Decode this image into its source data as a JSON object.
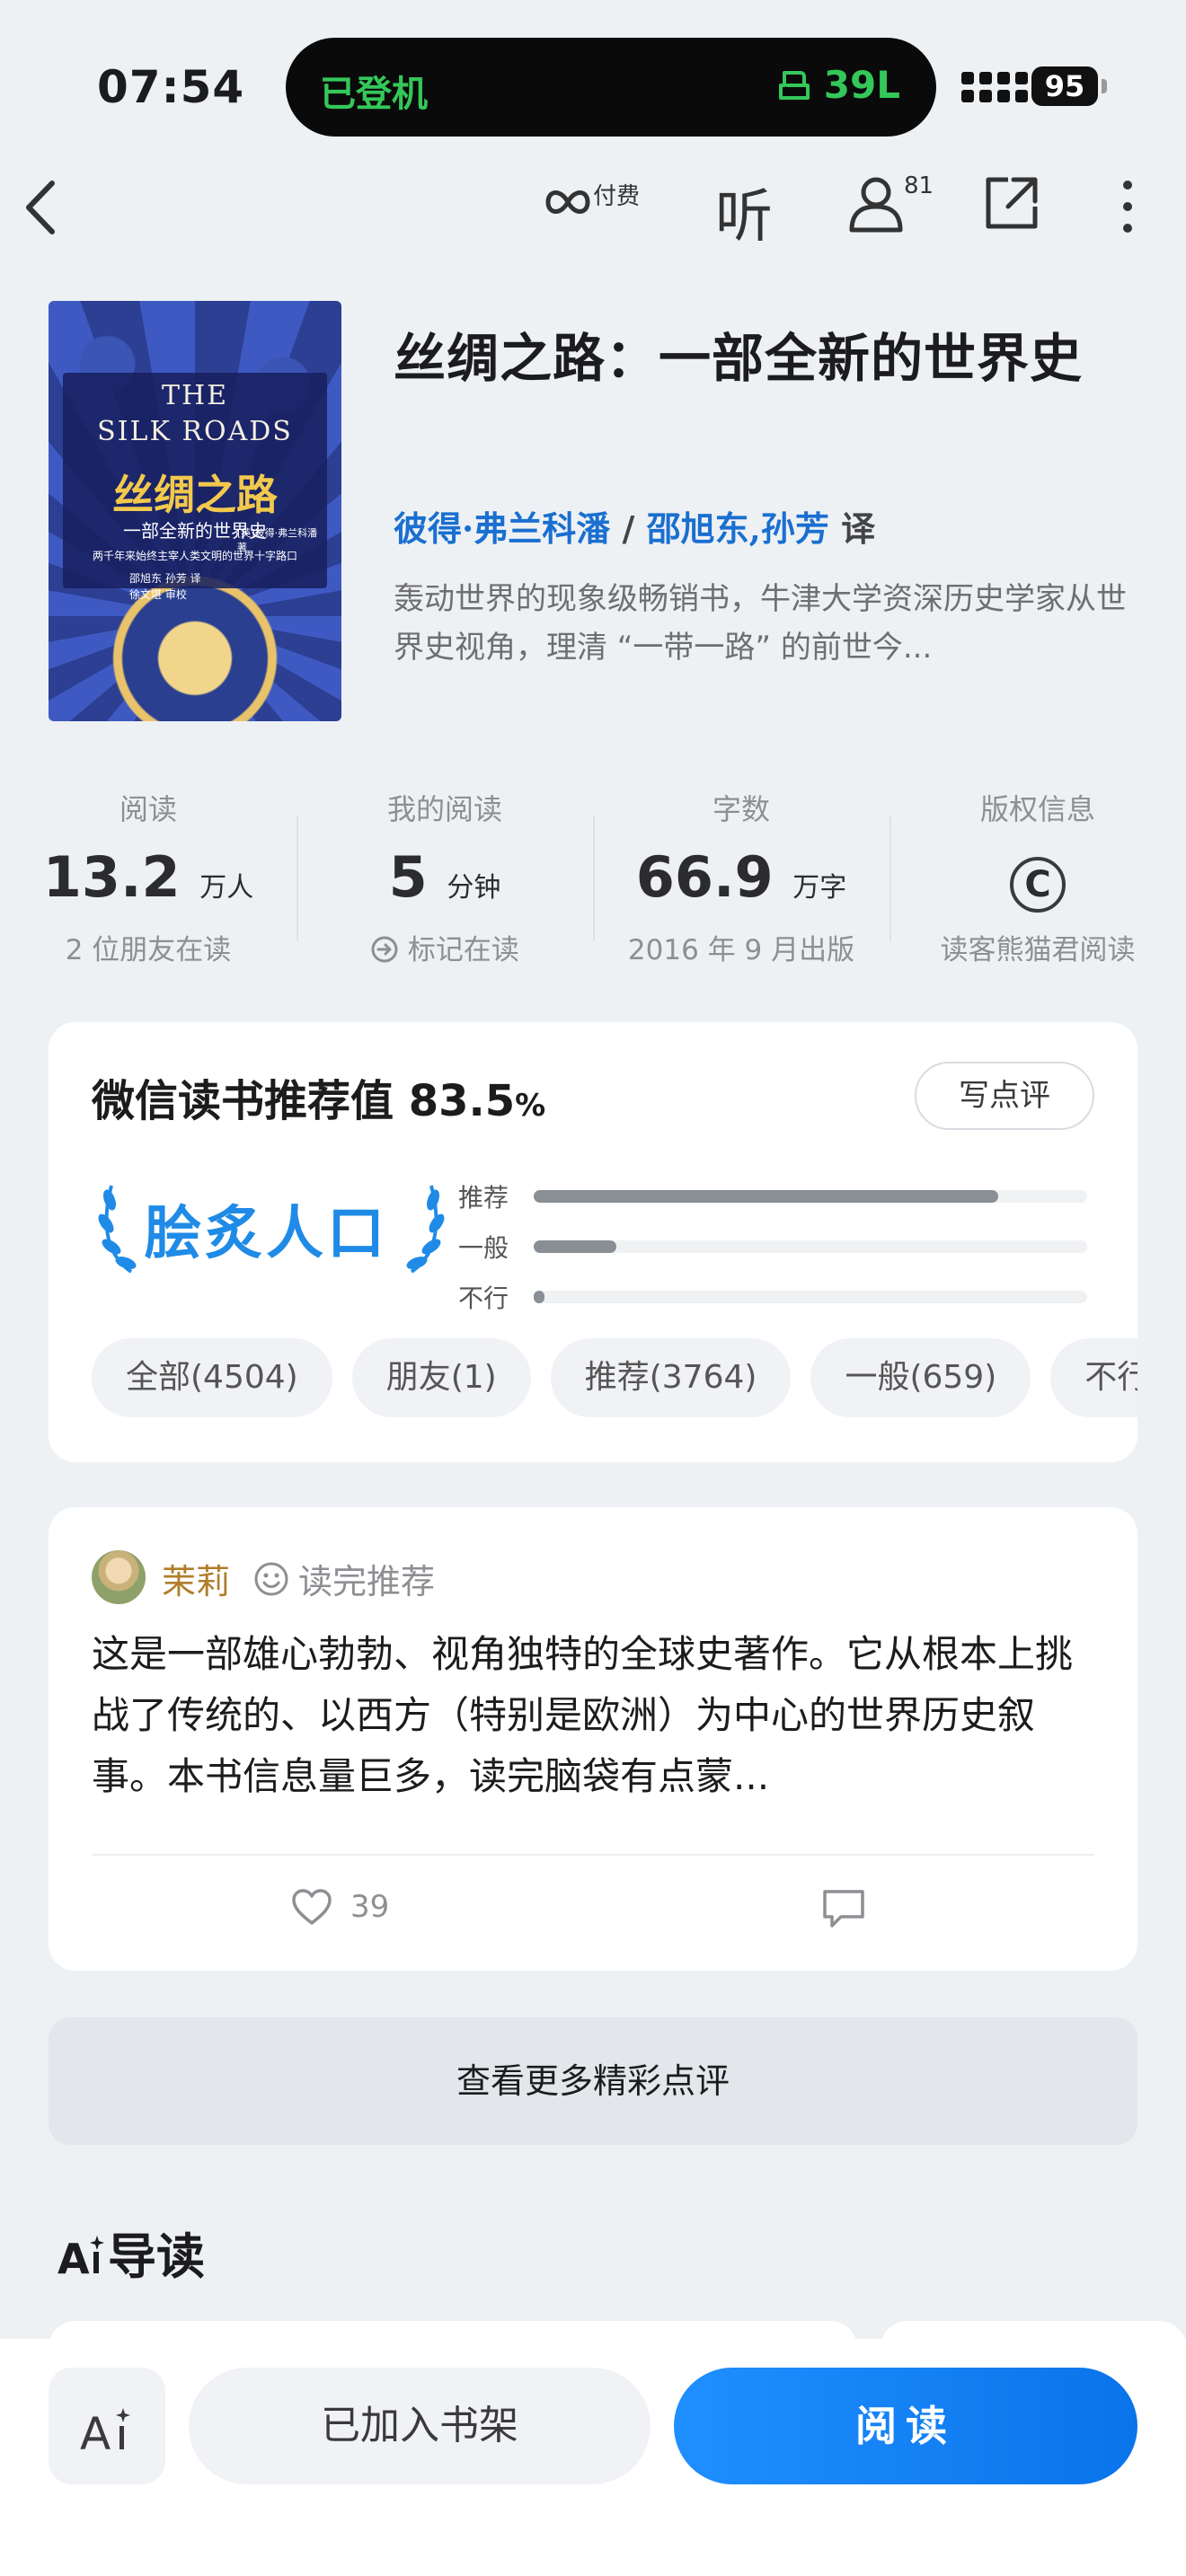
{
  "status_bar": {
    "time": "07:54",
    "flight_status": "已登机",
    "seat": "39L",
    "battery": "95"
  },
  "nav": {
    "paid_label": "付费",
    "listen_label": "听",
    "reader_count": "81"
  },
  "book": {
    "cover": {
      "title_en_line1": "THE",
      "title_en_line2": "SILK ROADS",
      "title_cn": "丝绸之路",
      "subtitle_cn": "一部全新的世界史",
      "tagline": "两千年来始终主宰人类文明的世界十字路口",
      "author": "[英]彼得·弗兰科潘 著",
      "translators": "邵旭东 孙芳 译",
      "reviewer": "徐文堪 审校"
    },
    "title": "丝绸之路：一部全新的世界史",
    "author": "彼得·弗兰科潘",
    "separator": " / ",
    "translator_1": "邵旭东",
    "translator_2": "孙芳",
    "translator_suffix": " 译",
    "blurb": "轰动世界的现象级畅销书，牛津大学资深历史学家从世界史视角，理清 “一带一路” 的前世今..."
  },
  "stats": [
    {
      "label": "阅读",
      "value": "13.2",
      "unit": "万人",
      "sub": "2 位朋友在读"
    },
    {
      "label": "我的阅读",
      "value": "5",
      "unit": "分钟",
      "sub": "标记在读"
    },
    {
      "label": "字数",
      "value": "66.9",
      "unit": "万字",
      "sub": "2016 年 9 月出版"
    },
    {
      "label": "版权信息",
      "value": "",
      "unit": "",
      "sub": "读客熊猫君阅读"
    }
  ],
  "recommend": {
    "title": "微信读书推荐值",
    "value": "83.5",
    "pct": "%",
    "write_button": "写点评",
    "badge": "脍炙人口",
    "bars": [
      {
        "label": "推荐",
        "fraction": 0.84
      },
      {
        "label": "一般",
        "fraction": 0.15
      },
      {
        "label": "不行",
        "fraction": 0.02
      }
    ],
    "chips": [
      "全部(4504)",
      "朋友(1)",
      "推荐(3764)",
      "一般(659)",
      "不行"
    ]
  },
  "review": {
    "name": "茉莉",
    "tag": "读完推荐",
    "body": "这是一部雄心勃勃、视角独特的全球史著作。它从根本上挑战了传统的、以西方（特别是欧洲）为中心的世界历史叙事。本书信息量巨多，读完脑袋有点蒙...",
    "likes": "39"
  },
  "more_reviews": "查看更多精彩点评",
  "ai_guide_title": "导读",
  "bottom": {
    "ai_label": "Ai",
    "shelf_button": "已加入书架",
    "read_button": "阅读"
  },
  "colors": {
    "accent_blue": "#1a6fd0",
    "read_button": "#0a74ea",
    "badge_blue": "#1f8be6",
    "island_green": "#34c759"
  }
}
